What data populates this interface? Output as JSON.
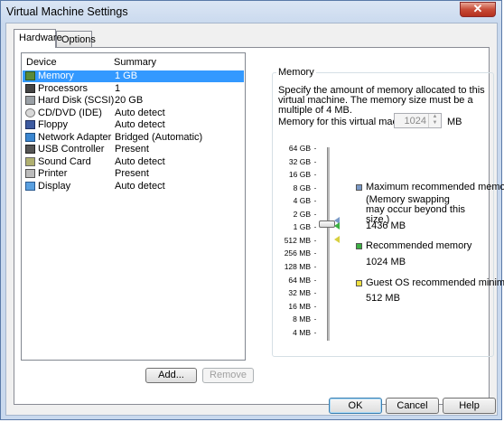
{
  "window": {
    "title": "Virtual Machine Settings",
    "close_glyph": "✕"
  },
  "tabs": [
    {
      "label": "Hardware",
      "active": true
    },
    {
      "label": "Options",
      "active": false
    }
  ],
  "device_list": {
    "headers": {
      "device": "Device",
      "summary": "Summary"
    },
    "items": [
      {
        "name": "Memory",
        "summary": "1 GB",
        "icon": "memory-icon",
        "selected": true
      },
      {
        "name": "Processors",
        "summary": "1",
        "icon": "processor-icon"
      },
      {
        "name": "Hard Disk (SCSI)",
        "summary": "20 GB",
        "icon": "hard-disk-icon"
      },
      {
        "name": "CD/DVD (IDE)",
        "summary": "Auto detect",
        "icon": "cd-dvd-icon"
      },
      {
        "name": "Floppy",
        "summary": "Auto detect",
        "icon": "floppy-icon"
      },
      {
        "name": "Network Adapter",
        "summary": "Bridged (Automatic)",
        "icon": "network-adapter-icon"
      },
      {
        "name": "USB Controller",
        "summary": "Present",
        "icon": "usb-icon"
      },
      {
        "name": "Sound Card",
        "summary": "Auto detect",
        "icon": "sound-card-icon"
      },
      {
        "name": "Printer",
        "summary": "Present",
        "icon": "printer-icon"
      },
      {
        "name": "Display",
        "summary": "Auto detect",
        "icon": "display-icon"
      }
    ]
  },
  "buttons": {
    "add": "Add...",
    "remove": "Remove",
    "ok": "OK",
    "cancel": "Cancel",
    "help": "Help"
  },
  "memory": {
    "group_title": "Memory",
    "description": "Specify the amount of memory allocated to this virtual machine. The memory size must be a multiple of 4 MB.",
    "field_label": "Memory for this virtual machine:",
    "value": "1024",
    "unit": "MB",
    "scale_labels": [
      "64 GB",
      "32 GB",
      "16 GB",
      "8 GB",
      "4 GB",
      "2 GB",
      "1 GB",
      "512 MB",
      "256 MB",
      "128 MB",
      "64 MB",
      "32 MB",
      "16 MB",
      "8 MB",
      "4 MB"
    ],
    "legend": {
      "max": {
        "label": "Maximum recommended memory",
        "note": "(Memory swapping may occur beyond this size.)",
        "value": "1436 MB",
        "color": "#7b9ac7"
      },
      "recommended": {
        "label": "Recommended memory",
        "value": "1024 MB",
        "color": "#3cb043"
      },
      "guest_min": {
        "label": "Guest OS recommended minimum",
        "value": "512 MB",
        "color": "#f0e040"
      }
    }
  }
}
